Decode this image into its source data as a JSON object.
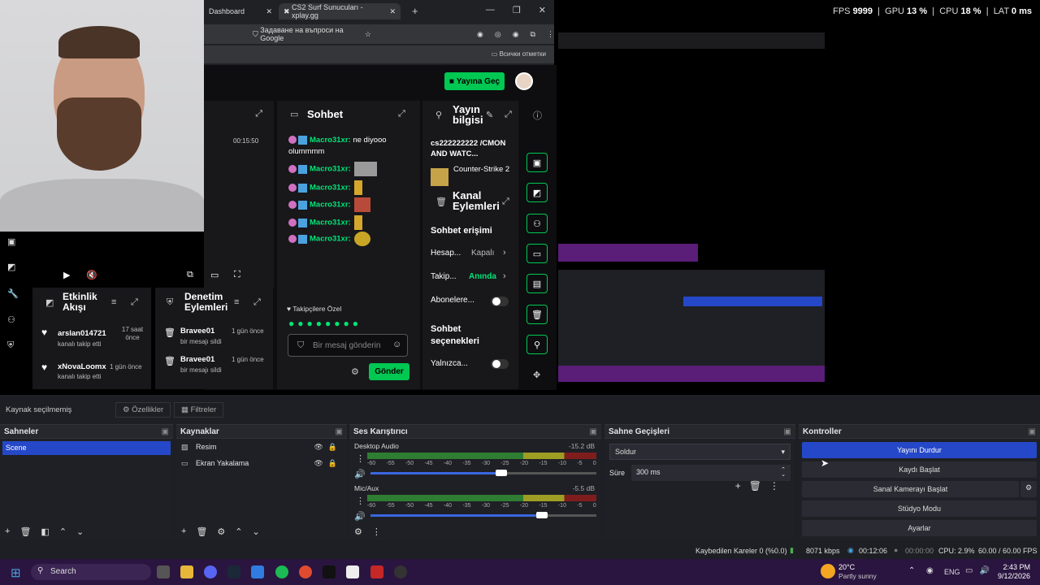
{
  "preview_stats": {
    "fps_label": "FPS",
    "fps": "9999",
    "gpu_label": "GPU",
    "gpu": "13 %",
    "cpu_label": "CPU",
    "cpu": "18 %",
    "lat_label": "LAT",
    "lat": "0 ms"
  },
  "browser": {
    "tab1": "Dashboard",
    "tab2": "CS2 Surf Sunucuları - xplay.gg",
    "address": "Задаване на въпроси на Google",
    "bookmarks": "Всички отметки"
  },
  "dashboard": {
    "go_live": "Yayına Geç",
    "chat": {
      "title": "Sohbet",
      "messages": [
        {
          "user": "Macro31xr:",
          "text": "ne diyooo olummmm"
        },
        {
          "user": "Macro31xr:",
          "text": ""
        },
        {
          "user": "Macro31xr:",
          "text": ""
        },
        {
          "user": "Macro31xr:",
          "text": ""
        },
        {
          "user": "Macro31xr:",
          "text": ""
        },
        {
          "user": "Macro31xr:",
          "text": ""
        }
      ],
      "followers_only": "Takipçilere Özel",
      "placeholder": "Bir mesaj gönderin",
      "send": "Gönder"
    },
    "stream_info": {
      "title": "Yayın bilgisi",
      "stream_title": "cs222222222 /CMON AND WATC...",
      "game": "Counter-Strike 2",
      "channel_actions": "Kanal Eylemleri",
      "chat_access": "Sohbet erişimi",
      "account_label": "Hesap...",
      "account_value": "Kapalı",
      "follow_label": "Takip...",
      "follow_value": "Anında",
      "subs_label": "Abonelere...",
      "chat_options": "Sohbet seçenekleri",
      "only_label": "Yalnızca..."
    },
    "activity": {
      "title": "Etkinlik Akışı",
      "items": [
        {
          "name": "arslan014721",
          "sub": "kanalı takip etti",
          "time": "17 saat önce"
        },
        {
          "name": "xNovaLoomx",
          "sub": "kanalı takip etti",
          "time": "1 gün önce"
        }
      ]
    },
    "moderation": {
      "title": "Denetim Eylemleri",
      "items": [
        {
          "name": "Bravee01",
          "sub": "bir mesajı sildi",
          "time": "1 gün önce"
        },
        {
          "name": "Bravee01",
          "sub": "bir mesajı sildi",
          "time": "1 gün önce"
        }
      ]
    },
    "timer": "00:15:50"
  },
  "obs": {
    "source_bar": {
      "no_source": "Kaynak seçilmemiş",
      "properties": "Özellikler",
      "filters": "Filtreler"
    },
    "scenes": {
      "title": "Sahneler",
      "items": [
        "Scene"
      ]
    },
    "sources": {
      "title": "Kaynaklar",
      "items": [
        "Resim",
        "Ekran Yakalama"
      ]
    },
    "mixer": {
      "title": "Ses Karıştırıcı",
      "channels": [
        {
          "name": "Desktop Audio",
          "db": "-15.2 dB",
          "level": 0.58
        },
        {
          "name": "Mic/Aux",
          "db": "-5.5 dB",
          "level": 0.76
        }
      ],
      "ticks": [
        "-60",
        "-55",
        "-50",
        "-45",
        "-40",
        "-35",
        "-30",
        "-25",
        "-20",
        "-15",
        "-10",
        "-5",
        "0"
      ]
    },
    "transitions": {
      "title": "Sahne Geçişleri",
      "selected": "Soldur",
      "duration_label": "Süre",
      "duration": "300 ms"
    },
    "controls": {
      "title": "Kontroller",
      "stop_stream": "Yayını Durdur",
      "start_recording": "Kaydı Başlat",
      "virtual_camera": "Sanal Kamerayı Başlat",
      "studio_mode": "Stüdyo Modu",
      "settings": "Ayarlar"
    },
    "status": {
      "dropped": "Kaybedilen Kareler 0 (%0.0)",
      "bitrate": "8071 kbps",
      "stream_time": "00:12:06",
      "rec_time": "00:00:00",
      "cpu": "CPU: 2.9%",
      "fps": "60.00 / 60.00 FPS"
    }
  },
  "taskbar": {
    "search": "Search",
    "weather_temp": "20°C",
    "weather_desc": "Partly sunny",
    "lang": "ENG",
    "time": "2:43 PM",
    "date": "9/12/2026"
  },
  "colors": {
    "accent_green": "#00c853",
    "obs_blue": "#2548c8",
    "taskbar": "#2a1540"
  }
}
